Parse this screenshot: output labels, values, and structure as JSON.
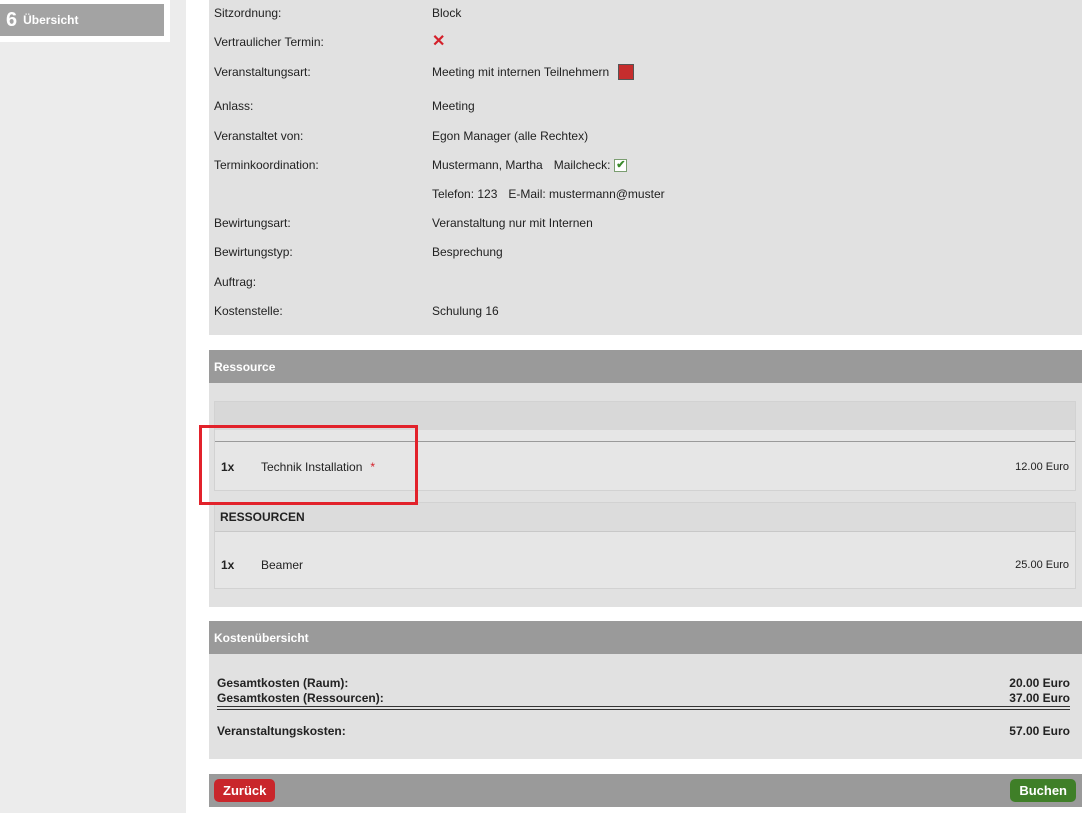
{
  "sidebar": {
    "step_number": "6",
    "step_label": "Übersicht"
  },
  "details": [
    {
      "label": "Sitzordnung:",
      "value": "Block"
    },
    {
      "label": "Vertraulicher Termin:",
      "value": "✕"
    },
    {
      "label": "Veranstaltungsart:",
      "value": "Meeting mit internen Teilnehmern",
      "color": "#c62d2d"
    },
    {
      "label": "Anlass:",
      "value": "Meeting"
    },
    {
      "label": "Veranstaltet von:",
      "value": "Egon Manager (alle Rechtex)"
    },
    {
      "label": "Terminkoordination:",
      "value": "Mustermann, Martha",
      "mailcheck_label": "Mailcheck:",
      "mailcheck_checked": true
    },
    {
      "label": "",
      "phone": "Telefon: 123",
      "email": "E-Mail: mustermann@muster"
    },
    {
      "label": "Bewirtungsart:",
      "value": "Veranstaltung nur mit Internen"
    },
    {
      "label": "Bewirtungstyp:",
      "value": "Besprechung"
    },
    {
      "label": "Auftrag:",
      "value": ""
    },
    {
      "label": "Kostenstelle:",
      "value": "Schulung 16"
    }
  ],
  "ressource": {
    "header": "Ressource",
    "first_item": {
      "qty": "1x",
      "name": "Technik Installation",
      "required_mark": "*",
      "price": "12.00 Euro"
    },
    "group_title": "RESSOURCEN",
    "second_item": {
      "qty": "1x",
      "name": "Beamer",
      "price": "25.00 Euro"
    }
  },
  "kosten": {
    "header": "Kostenübersicht",
    "raum_label": "Gesamtkosten (Raum):",
    "raum_value": "20.00 Euro",
    "res_label": "Gesamtkosten (Ressourcen):",
    "res_value": "37.00 Euro",
    "total_label": "Veranstaltungskosten:",
    "total_value": "57.00 Euro"
  },
  "footer": {
    "back_label": "Zurück",
    "book_label": "Buchen"
  },
  "colors": {
    "back": "#c9262b",
    "book": "#3f7f28",
    "highlight": "#e2222b"
  }
}
